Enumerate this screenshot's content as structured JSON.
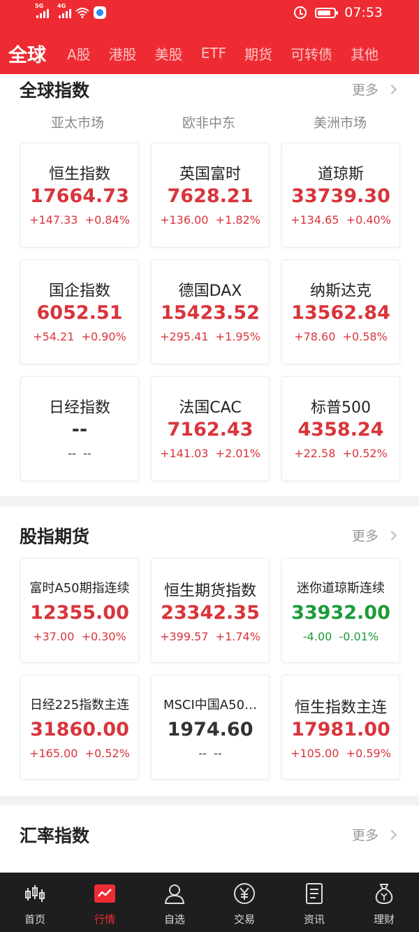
{
  "status_bar": {
    "signal1": "5G",
    "signal2": "4G",
    "time": "07:53"
  },
  "tabs": [
    "全球",
    "A股",
    "港股",
    "美股",
    "ETF",
    "期货",
    "可转债",
    "其他"
  ],
  "global_indices": {
    "title": "全球指数",
    "more": "更多",
    "regions": [
      "亚太市场",
      "欧非中东",
      "美洲市场"
    ],
    "cards": [
      {
        "name": "恒生指数",
        "price": "17664.73",
        "change": "+147.33",
        "pct": "+0.84%"
      },
      {
        "name": "英国富时",
        "price": "7628.21",
        "change": "+136.00",
        "pct": "+1.82%"
      },
      {
        "name": "道琼斯",
        "price": "33739.30",
        "change": "+134.65",
        "pct": "+0.40%"
      },
      {
        "name": "国企指数",
        "price": "6052.51",
        "change": "+54.21",
        "pct": "+0.90%"
      },
      {
        "name": "德国DAX",
        "price": "15423.52",
        "change": "+295.41",
        "pct": "+1.95%"
      },
      {
        "name": "纳斯达克",
        "price": "13562.84",
        "change": "+78.60",
        "pct": "+0.58%"
      },
      {
        "name": "日经指数",
        "price": "--",
        "change": "--",
        "pct": "--"
      },
      {
        "name": "法国CAC",
        "price": "7162.43",
        "change": "+141.03",
        "pct": "+2.01%"
      },
      {
        "name": "标普500",
        "price": "4358.24",
        "change": "+22.58",
        "pct": "+0.52%"
      }
    ]
  },
  "index_futures": {
    "title": "股指期货",
    "more": "更多",
    "cards": [
      {
        "name": "富时A50期指连续",
        "price": "12355.00",
        "change": "+37.00",
        "pct": "+0.30%"
      },
      {
        "name": "恒生期货指数",
        "price": "23342.35",
        "change": "+399.57",
        "pct": "+1.74%"
      },
      {
        "name": "迷你道琼斯连续",
        "price": "33932.00",
        "change": "-4.00",
        "pct": "-0.01%"
      },
      {
        "name": "日经225指数主连",
        "price": "31860.00",
        "change": "+165.00",
        "pct": "+0.52%"
      },
      {
        "name": "MSCI中国A50…",
        "price": "1974.60",
        "change": "--",
        "pct": "--"
      },
      {
        "name": "恒生指数主连",
        "price": "17981.00",
        "change": "+105.00",
        "pct": "+0.59%"
      }
    ]
  },
  "fx_indices": {
    "title": "汇率指数",
    "more": "更多"
  },
  "bottom_nav": [
    "首页",
    "行情",
    "自选",
    "交易",
    "资讯",
    "理财"
  ],
  "colors": {
    "brand_red": "#ee2b32",
    "up": "#d9343b",
    "down": "#1b9b3a"
  }
}
